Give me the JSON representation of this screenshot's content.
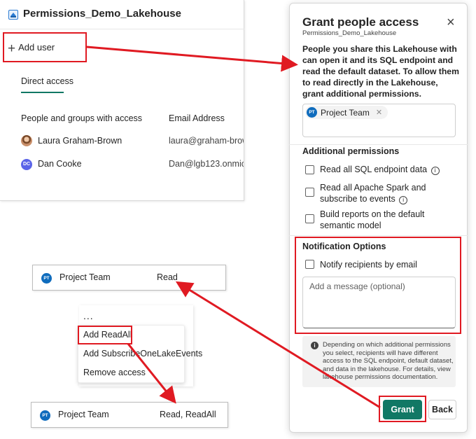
{
  "permissions_panel": {
    "title": "Permissions_Demo_Lakehouse",
    "add_user_label": "Add user",
    "tab_direct_access": "Direct access",
    "columns": [
      "People and groups with access",
      "Email Address"
    ],
    "rows": [
      {
        "name": "Laura Graham-Brown",
        "email": "laura@graham-brow",
        "avatar": "photo"
      },
      {
        "name": "Dan Cooke",
        "email": "Dan@lgb123.onmicr",
        "initials": "DC"
      }
    ]
  },
  "dialog": {
    "title": "Grant people access",
    "subtitle": "Permissions_Demo_Lakehouse",
    "description": "People you share this Lakehouse with can open it and its SQL endpoint and read the default dataset. To allow them to read directly in the Lakehouse, grant additional permissions.",
    "chip": {
      "initials": "PT",
      "label": "Project Team"
    },
    "additional_permissions_heading": "Additional permissions",
    "permissions": [
      {
        "label": "Read all SQL endpoint data",
        "info": true,
        "checked": false
      },
      {
        "label": "Read all Apache Spark and subscribe to events",
        "info": true,
        "checked": false
      },
      {
        "label": "Build reports on the default semantic model",
        "info": false,
        "checked": false
      }
    ],
    "notification_heading": "Notification Options",
    "notify_label": "Notify recipients by email",
    "notify_checked": false,
    "message_placeholder": "Add a message (optional)",
    "info_text": "Depending on which additional permissions you select, recipients will have different access to the SQL endpoint, default dataset, and data in the lakehouse. For details, view lakehouse permissions documentation.",
    "grant_label": "Grant",
    "back_label": "Back"
  },
  "card_before": {
    "initials": "PT",
    "name": "Project Team",
    "permission": "Read"
  },
  "context_menu": {
    "ellipsis": "...",
    "items": [
      "Add ReadAll",
      "Add SubscribeOneLakeEvents",
      "Remove access"
    ]
  },
  "card_after": {
    "initials": "PT",
    "name": "Project Team",
    "permission": "Read, ReadAll"
  },
  "colors": {
    "accent": "#117865",
    "highlight": "#e01a22",
    "avatar_blue": "#0f6cbd"
  }
}
